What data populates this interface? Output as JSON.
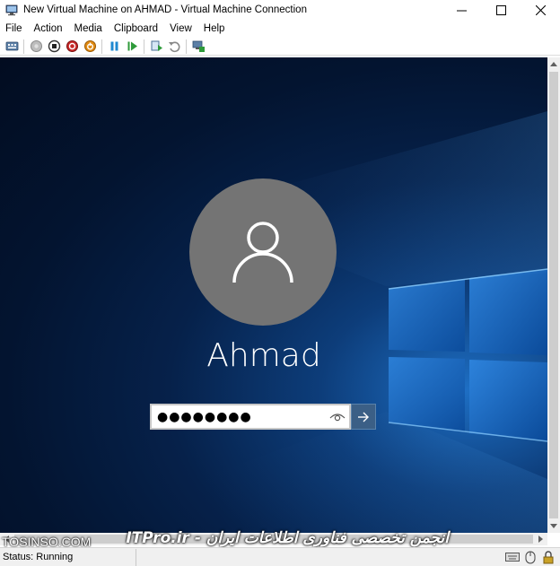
{
  "window": {
    "title": "New Virtual Machine on AHMAD - Virtual Machine Connection",
    "icon": "vm-connection-icon"
  },
  "menu": {
    "items": [
      {
        "label": "File"
      },
      {
        "label": "Action"
      },
      {
        "label": "Media"
      },
      {
        "label": "Clipboard"
      },
      {
        "label": "View"
      },
      {
        "label": "Help"
      }
    ]
  },
  "toolbar": {
    "buttons": [
      "ctrl-alt-del-icon",
      "start-icon",
      "turn-off-icon",
      "shutdown-icon",
      "save-icon",
      "pause-icon",
      "resume-icon",
      "checkpoint-icon",
      "revert-icon",
      "enhanced-session-icon"
    ]
  },
  "lock_screen": {
    "username": "Ahmad",
    "password_value": "●●●●●●●●",
    "avatar_icon": "user-avatar-icon",
    "reveal_icon": "eye-icon",
    "submit_icon": "arrow-right-icon"
  },
  "watermark": {
    "left": "TOSINSO.COM",
    "right": "ITPro.ir - انجمن تخصصی فناوری اطلاعات ایران"
  },
  "status": {
    "text": "Status: Running"
  },
  "colors": {
    "avatar_bg": "#747474",
    "submit_bg": "#3b5f86",
    "desktop_dark": "#020c20",
    "desktop_light": "#1e6fc4"
  }
}
